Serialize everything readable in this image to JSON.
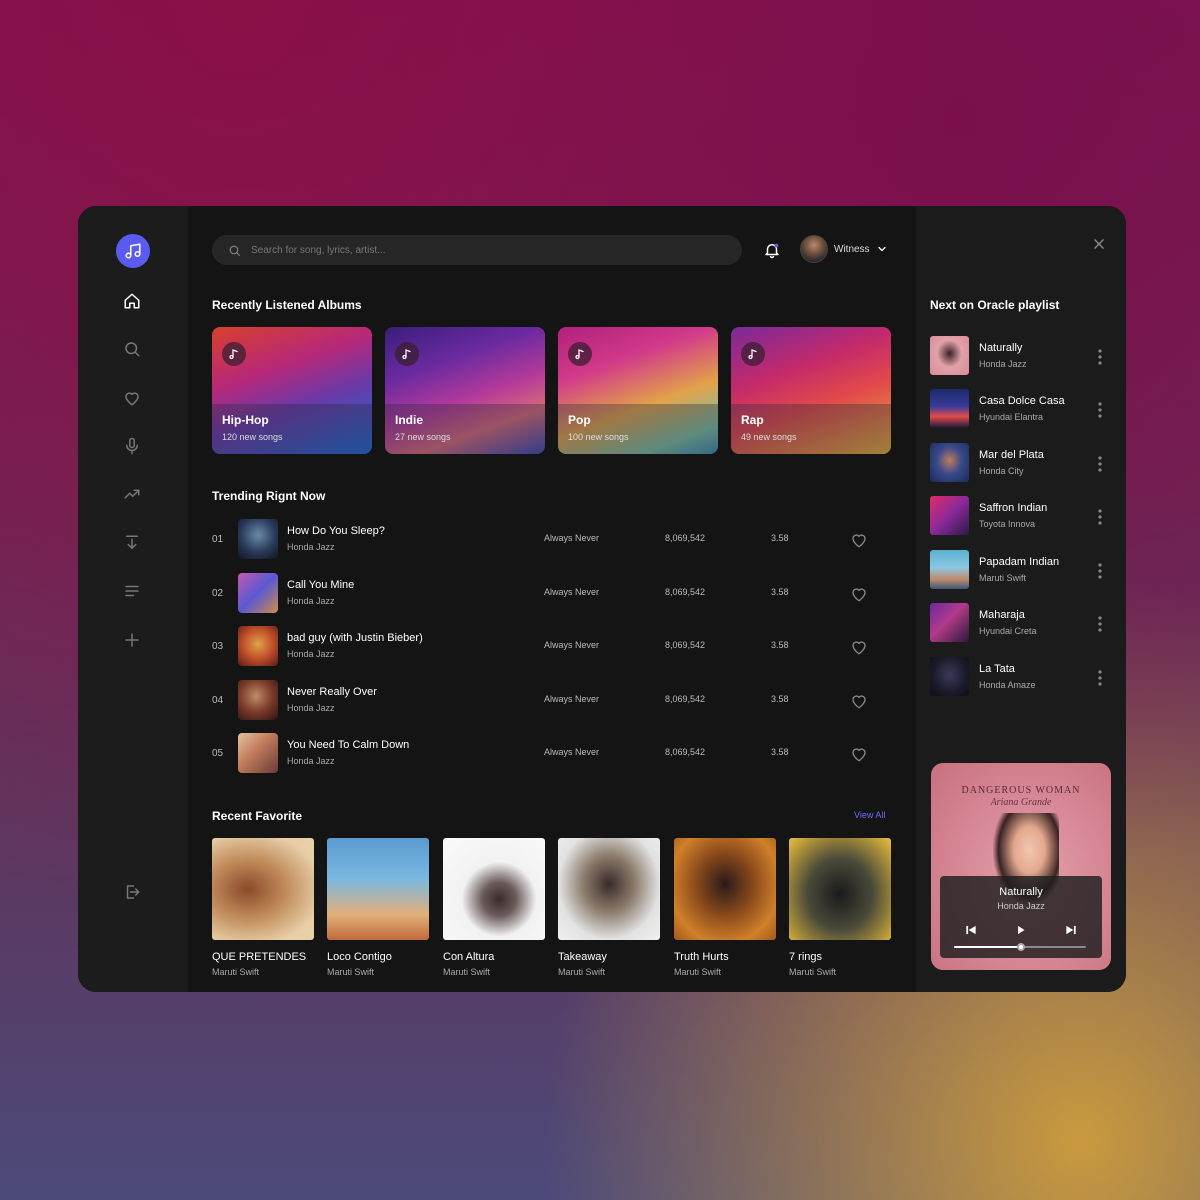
{
  "search": {
    "placeholder": "Search for song, lyrics, artist..."
  },
  "user": {
    "name": "Witness"
  },
  "sidebar": {
    "items": [
      {
        "name": "home",
        "icon": "home-icon"
      },
      {
        "name": "search",
        "icon": "search-icon"
      },
      {
        "name": "favorites",
        "icon": "heart-icon"
      },
      {
        "name": "microphone",
        "icon": "microphone-icon"
      },
      {
        "name": "trending",
        "icon": "trending-icon"
      },
      {
        "name": "download",
        "icon": "download-icon"
      },
      {
        "name": "playlist",
        "icon": "list-icon"
      },
      {
        "name": "add",
        "icon": "plus-icon"
      }
    ],
    "logout_icon": "logout-icon"
  },
  "recent_albums": {
    "title": "Recently Listened Albums",
    "items": [
      {
        "title": "Hip-Hop",
        "sub": "120 new songs"
      },
      {
        "title": "Indie",
        "sub": "27 new songs"
      },
      {
        "title": "Pop",
        "sub": "100 new songs"
      },
      {
        "title": "Rap",
        "sub": "49 new songs"
      }
    ]
  },
  "trending": {
    "title": "Trending Rignt Now",
    "tracks": [
      {
        "num": "01",
        "name": "How Do You Sleep?",
        "artist": "Honda Jazz",
        "album": "Always Never",
        "plays": "8,069,542",
        "duration": "3.58"
      },
      {
        "num": "02",
        "name": "Call You Mine",
        "artist": "Honda Jazz",
        "album": "Always Never",
        "plays": "8,069,542",
        "duration": "3.58"
      },
      {
        "num": "03",
        "name": "bad guy (with Justin Bieber)",
        "artist": "Honda Jazz",
        "album": "Always Never",
        "plays": "8,069,542",
        "duration": "3.58"
      },
      {
        "num": "04",
        "name": "Never Really Over",
        "artist": "Honda Jazz",
        "album": "Always Never",
        "plays": "8,069,542",
        "duration": "3.58"
      },
      {
        "num": "05",
        "name": "You Need To Calm Down",
        "artist": "Honda Jazz",
        "album": "Always Never",
        "plays": "8,069,542",
        "duration": "3.58"
      }
    ]
  },
  "favorites": {
    "title": "Recent Favorite",
    "view_all": "View All",
    "items": [
      {
        "title": "QUE PRETENDES",
        "artist": "Maruti Swift"
      },
      {
        "title": "Loco Contigo",
        "artist": "Maruti Swift"
      },
      {
        "title": "Con Altura",
        "artist": "Maruti Swift"
      },
      {
        "title": "Takeaway",
        "artist": "Maruti Swift"
      },
      {
        "title": "Truth Hurts",
        "artist": "Maruti Swift"
      },
      {
        "title": "7 rings",
        "artist": "Maruti Swift"
      }
    ]
  },
  "up_next": {
    "title": "Next on Oracle playlist",
    "items": [
      {
        "title": "Naturally",
        "artist": "Honda Jazz"
      },
      {
        "title": "Casa Dolce Casa",
        "artist": "Hyundai Elantra"
      },
      {
        "title": "Mar del Plata",
        "artist": "Honda City"
      },
      {
        "title": "Saffron Indian",
        "artist": "Toyota Innova"
      },
      {
        "title": "Papadam Indian",
        "artist": "Maruti Swift"
      },
      {
        "title": "Maharaja",
        "artist": "Hyundai Creta"
      },
      {
        "title": "La Tata",
        "artist": "Honda Amaze"
      }
    ]
  },
  "now_playing": {
    "cover_headline": "DANGEROUS WOMAN",
    "cover_script": "Ariana Grande",
    "title": "Naturally",
    "artist": "Honda Jazz",
    "progress": 0.51
  },
  "colors": {
    "accent": "#5b5bf0",
    "link": "#6a6af5",
    "app_bg": "#141414",
    "sidebar_bg": "#1c1c1c"
  }
}
